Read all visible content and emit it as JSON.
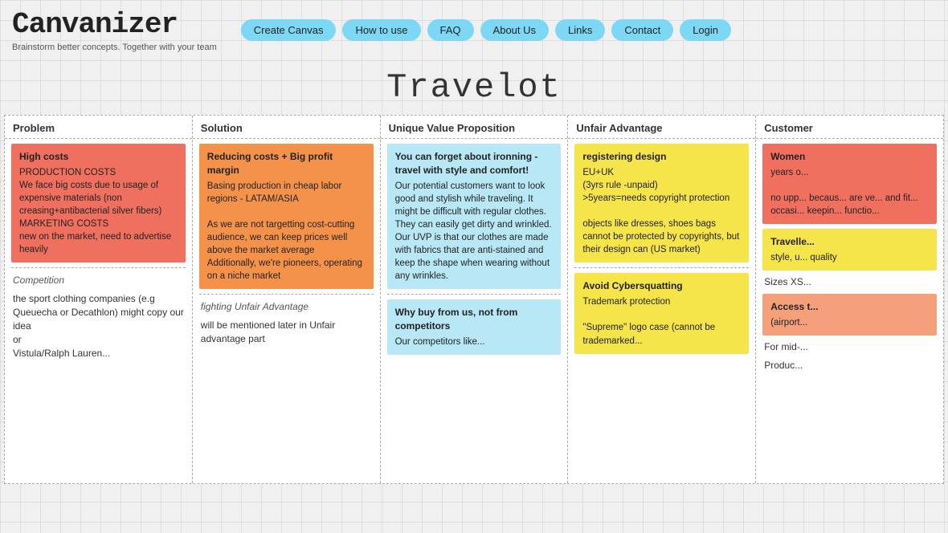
{
  "header": {
    "logo": "Canvanizer",
    "subtitle": "Brainstorm better concepts. Together with your team",
    "nav": [
      {
        "label": "Create Canvas"
      },
      {
        "label": "How to use"
      },
      {
        "label": "FAQ"
      },
      {
        "label": "About Us"
      },
      {
        "label": "Links"
      },
      {
        "label": "Contact"
      },
      {
        "label": "Login"
      }
    ]
  },
  "page": {
    "title": "Travelot"
  },
  "columns": [
    {
      "id": "problem",
      "header": "Problem",
      "sections": [
        {
          "type": "sticky",
          "color": "red",
          "title": "High costs",
          "body": "PRODUCTION COSTS\nWe face big costs due to usage of expensive materials (non creasing+antibacterial silver fibers)\nMARKETING COSTS\nnew on the market, need to advertise heavily"
        },
        {
          "type": "divider"
        },
        {
          "type": "label",
          "text": "Competition"
        },
        {
          "type": "static",
          "text": "the sport clothing companies (e.g Queuecha or Decathlon) might copy our idea\nor\nVistula/Ralph Lauren..."
        }
      ]
    },
    {
      "id": "solution",
      "header": "Solution",
      "sections": [
        {
          "type": "sticky",
          "color": "orange",
          "title": "Reducing costs + Big profit margin",
          "body": "Basing production in cheap labor regions - LATAM/ASIA\n\nAs we are not targetting cost-cutting audience, we can keep prices well above the market average\nAdditionally, we're pioneers, operating on a niche market"
        },
        {
          "type": "divider"
        },
        {
          "type": "label",
          "text": "fighting Unfair Advantage"
        },
        {
          "type": "static",
          "text": "will be mentioned later in Unfair advantage part"
        }
      ]
    },
    {
      "id": "uvp",
      "header": "Unique Value Proposition",
      "sections": [
        {
          "type": "sticky",
          "color": "light-blue",
          "title": "You can forget about ironning - travel with style and comfort!",
          "body": "Our potential customers want to look good and stylish while traveling. It might be difficult with regular clothes. They can easily get dirty and wrinkled. Our UVP is that our clothes are made with fabrics that are anti-stained and keep the shape when wearing without any wrinkles."
        },
        {
          "type": "divider"
        },
        {
          "type": "sticky",
          "color": "light-blue",
          "title": "Why buy from us, not from competitors",
          "body": "Our competitors like..."
        }
      ]
    },
    {
      "id": "unfair",
      "header": "Unfair Advantage",
      "sections": [
        {
          "type": "sticky",
          "color": "yellow",
          "title": "registering design",
          "body": "EU+UK\n(3yrs rule -unpaid)\n>5years=needs copyright protection\n\nobjects like dresses, shoes bags cannot be protected by copyrights, but their design can (US market)"
        },
        {
          "type": "divider"
        },
        {
          "type": "sticky",
          "color": "yellow",
          "title": "Avoid Cybersquatting",
          "body": "Trademark protection\n\n\"Supreme\" logo case (cannot be trademarked..."
        }
      ]
    },
    {
      "id": "customer",
      "header": "Customer",
      "sections": [
        {
          "type": "sticky",
          "color": "red",
          "title_partial": "Women",
          "body": "years o...\n\nno upp... becaus... are ve... and fit... occasi... keepin... functio..."
        },
        {
          "type": "sticky",
          "color": "yellow",
          "title": "Travelle...",
          "body": "style, u... quality"
        },
        {
          "type": "static",
          "text": "Sizes XS..."
        },
        {
          "type": "sticky",
          "color": "salmon",
          "title": "Access t...",
          "body": "(airport..."
        },
        {
          "type": "static",
          "text": "For mid-..."
        },
        {
          "type": "static",
          "text": "Produc..."
        }
      ]
    }
  ]
}
